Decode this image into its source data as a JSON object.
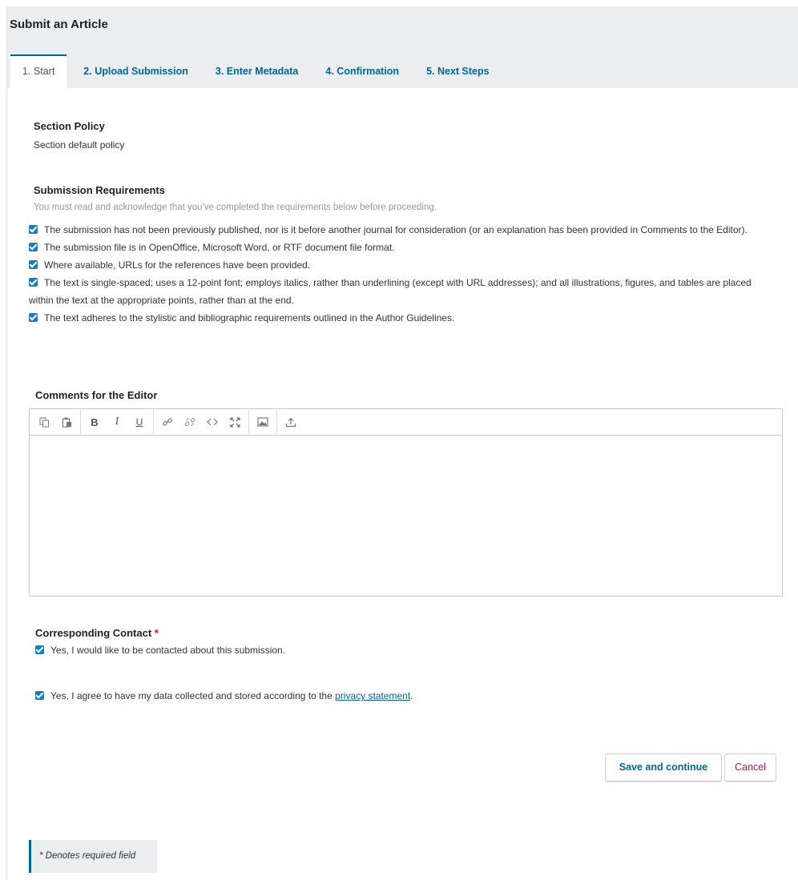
{
  "header": {
    "title": "Submit an Article"
  },
  "tabs": [
    {
      "label": "1. Start"
    },
    {
      "label": "2. Upload Submission"
    },
    {
      "label": "3. Enter Metadata"
    },
    {
      "label": "4. Confirmation"
    },
    {
      "label": "5. Next Steps"
    }
  ],
  "section_policy": {
    "heading": "Section Policy",
    "text": "Section default policy"
  },
  "requirements": {
    "heading": "Submission Requirements",
    "help": "You must read and acknowledge that you've completed the requirements below before proceeding.",
    "items": [
      "The submission has not been previously published, nor is it before another journal for consideration (or an explanation has been provided in Comments to the Editor).",
      "The submission file is in OpenOffice, Microsoft Word, or RTF document file format.",
      "Where available, URLs for the references have been provided.",
      "The text is single-spaced; uses a 12-point font; employs italics, rather than underlining (except with URL addresses); and all illustrations, figures, and tables are placed within the text at the appropriate points, rather than at the end.",
      "The text adheres to the stylistic and bibliographic requirements outlined in the Author Guidelines."
    ]
  },
  "comments": {
    "heading": "Comments for the Editor",
    "toolbar_icons": [
      "copy-icon",
      "paste-icon",
      "bold-icon",
      "italic-icon",
      "underline-icon",
      "link-icon",
      "unlink-icon",
      "code-icon",
      "fullscreen-icon",
      "image-icon",
      "upload-icon"
    ],
    "value": ""
  },
  "contact": {
    "heading": "Corresponding Contact",
    "required_mark": "*",
    "option": "Yes, I would like to be contacted about this submission."
  },
  "privacy": {
    "text_before": "Yes, I agree to have my data collected and stored according to the ",
    "link": "privacy statement",
    "text_after": "."
  },
  "buttons": {
    "save": "Save and continue",
    "cancel": "Cancel"
  },
  "notice": "* Denotes required field",
  "colors": {
    "accent": "#006798",
    "checkbox": "#1a7cc1",
    "required": "#d00a0a",
    "cancel": "#d00a5a"
  }
}
